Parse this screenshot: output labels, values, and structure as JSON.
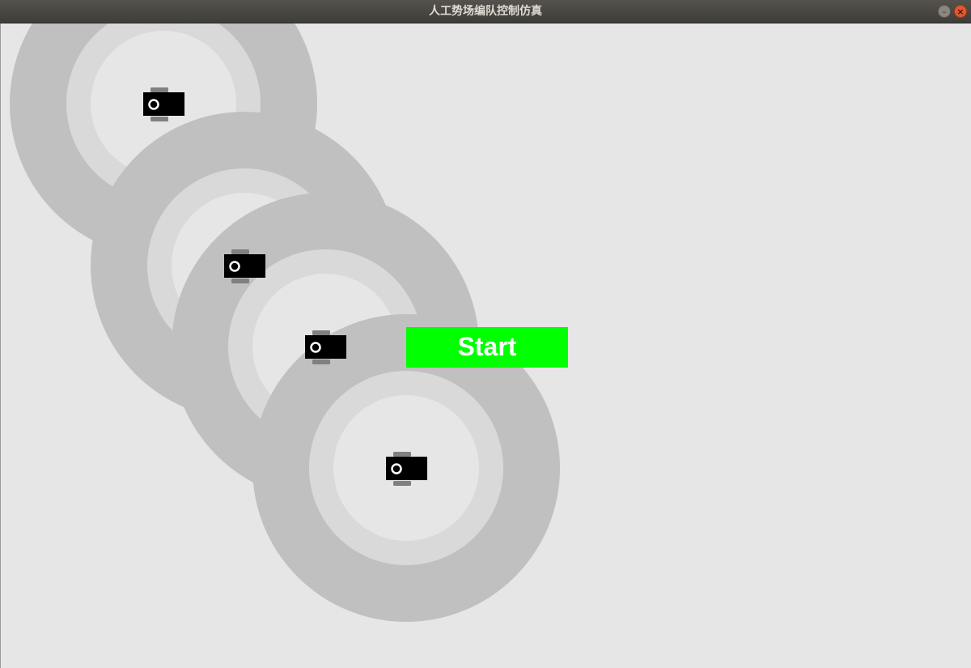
{
  "window": {
    "title": "人工势场编队控制仿真",
    "minimize_glyph": "–",
    "close_glyph": "×"
  },
  "colors": {
    "background": "#e6e6e6",
    "outer_field": "#c0c0c0",
    "middle_field": "#d9d9d9",
    "inner_field": "#e6e6e6",
    "robot_body": "#000000",
    "robot_wheel": "#808080",
    "robot_marker": "#ffffff",
    "start_button": "#00ff00"
  },
  "robots": [
    {
      "id": "robot-1"
    },
    {
      "id": "robot-2"
    },
    {
      "id": "robot-3"
    },
    {
      "id": "robot-4"
    }
  ],
  "start_button": {
    "label": "Start"
  }
}
